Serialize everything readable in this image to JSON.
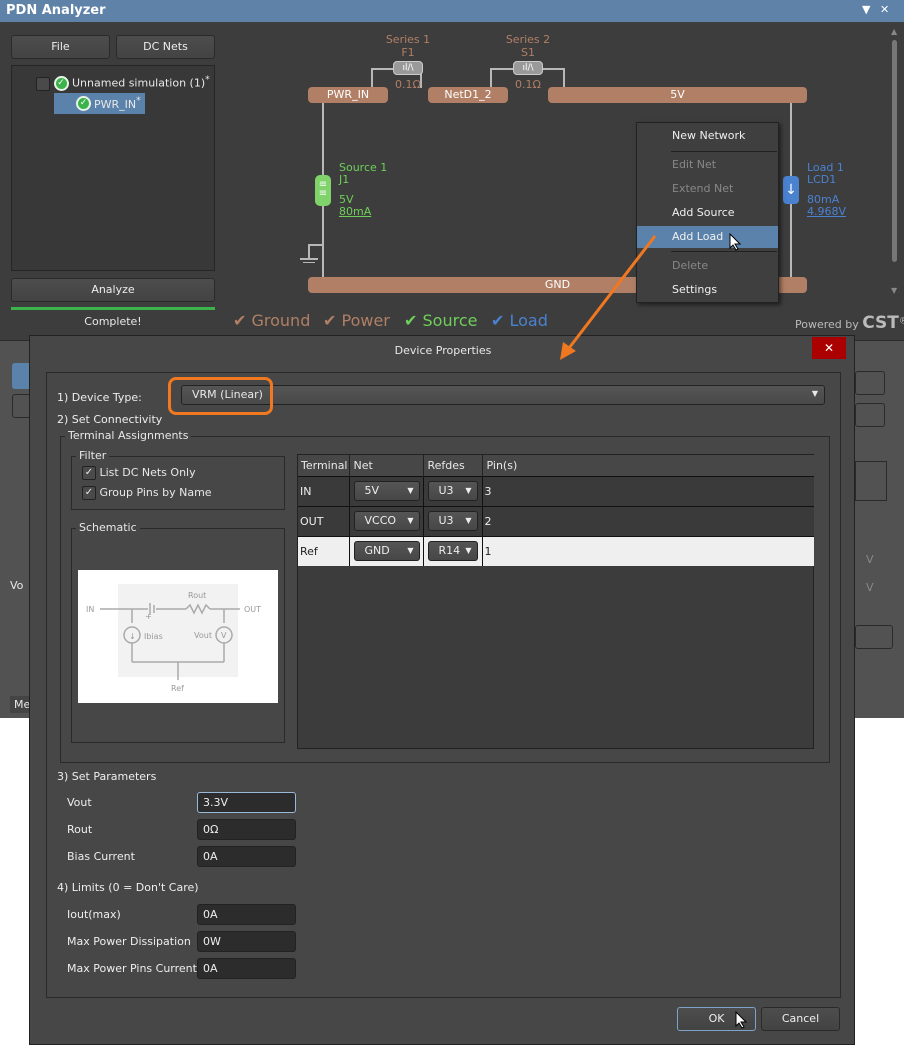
{
  "app": {
    "title": "PDN Analyzer",
    "pin_icon": "▼",
    "close_icon": "✕"
  },
  "toolbar": {
    "file": "File",
    "dc_nets": "DC Nets",
    "analyze": "Analyze",
    "status": "Complete!"
  },
  "tree": {
    "root": "Unnamed simulation (1)",
    "root_mark": "*",
    "child": "PWR_IN",
    "child_mark": "*"
  },
  "schematic": {
    "nets": [
      "PWR_IN",
      "NetD1_2",
      "5V",
      "GND"
    ],
    "series": [
      {
        "name": "Series 1",
        "ref": "F1",
        "value": "0.1Ω"
      },
      {
        "name": "Series 2",
        "ref": "S1",
        "value": "0.1Ω"
      }
    ],
    "source": {
      "name": "Source 1",
      "ref": "J1",
      "voltage": "5V",
      "current": "80mA"
    },
    "load": {
      "name": "Load 1",
      "ref": "LCD1",
      "current": "80mA",
      "voltage": "4.968V"
    },
    "legend": [
      "Ground",
      "Power",
      "Source",
      "Load"
    ],
    "powered_by": "Powered by",
    "brand": "CST",
    "reg": "®",
    "colors": {
      "net": "#b07f65",
      "source": "#6fcf5a",
      "load": "#4a82d0"
    }
  },
  "context_menu": [
    "New Network",
    "Edit Net",
    "Extend Net",
    "Add Source",
    "Add Load",
    "Delete",
    "Settings"
  ],
  "bg": {
    "partial": "Vo",
    "tab": "Me",
    "unit": "V"
  },
  "dialog": {
    "title": "Device Properties",
    "close": "✕",
    "device_type_label": "1) Device Type:",
    "device_type": "VRM (Linear)",
    "connectivity": "2) Set Connectivity",
    "terminal_assignments": "Terminal Assignments",
    "filter": "Filter",
    "list_dc": "List DC Nets Only",
    "group_pins": "Group Pins by Name",
    "schematic": "Schematic",
    "diagram": {
      "in": "IN",
      "out": "OUT",
      "rout": "Rout",
      "ibias": "Ibias",
      "vout": "Vout",
      "ref": "Ref",
      "plus": "+",
      "v": "V"
    },
    "table": {
      "headers": [
        "Terminal",
        "Net",
        "Refdes",
        "Pin(s)"
      ],
      "rows": [
        {
          "terminal": "IN",
          "net": "5V",
          "refdes": "U3",
          "pins": "3"
        },
        {
          "terminal": "OUT",
          "net": "VCCO",
          "refdes": "U3",
          "pins": "2"
        },
        {
          "terminal": "Ref",
          "net": "GND",
          "refdes": "R14",
          "pins": "1"
        }
      ]
    },
    "params_label": "3) Set Parameters",
    "params": [
      {
        "label": "Vout",
        "value": "3.3V"
      },
      {
        "label": "Rout",
        "value": "0Ω"
      },
      {
        "label": "Bias Current",
        "value": "0A"
      }
    ],
    "limits_label": "4) Limits (0 = Don't Care)",
    "limits": [
      {
        "label": "Iout(max)",
        "value": "0A"
      },
      {
        "label": "Max Power Dissipation",
        "value": "0W"
      },
      {
        "label": "Max Power Pins Current",
        "value": "0A"
      }
    ],
    "ok": "OK",
    "cancel": "Cancel"
  }
}
